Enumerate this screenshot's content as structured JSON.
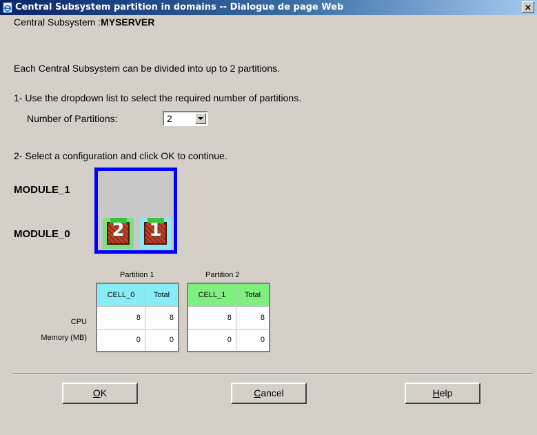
{
  "window": {
    "title": "Central Subsystem partition in domains -- Dialogue de page Web",
    "close_glyph": "×"
  },
  "subsystem": {
    "label": "Central Subsystem :",
    "name": "MYSERVER"
  },
  "intro": "Each Central Subsystem can be divided into up to 2 partitions.",
  "step1": "1- Use the dropdown list to select the required number of partitions.",
  "partitions_field": {
    "label": "Number of Partitions:",
    "value": "2"
  },
  "step2": "2- Select a configuration and click OK to continue.",
  "modules": [
    "MODULE_1",
    "MODULE_0"
  ],
  "cells": [
    {
      "number": "2",
      "color": "#7fe07f"
    },
    {
      "number": "1",
      "color": "#8fe7f0"
    }
  ],
  "row_labels": [
    "CPU",
    "Memory (MB)"
  ],
  "partition_tables": [
    {
      "title": "Partition 1",
      "headers": [
        "CELL_0",
        "Total"
      ],
      "cpu": [
        "8",
        "8"
      ],
      "memory": [
        "0",
        "0"
      ],
      "color": "#88ecf6"
    },
    {
      "title": "Partition 2",
      "headers": [
        "CELL_1",
        "Total"
      ],
      "cpu": [
        "8",
        "8"
      ],
      "memory": [
        "0",
        "0"
      ],
      "color": "#7fef7f"
    }
  ],
  "buttons": {
    "ok": {
      "accel": "O",
      "rest": "K"
    },
    "cancel": {
      "accel": "C",
      "rest": "ancel"
    },
    "help": {
      "accel": "H",
      "rest": "elp"
    }
  }
}
